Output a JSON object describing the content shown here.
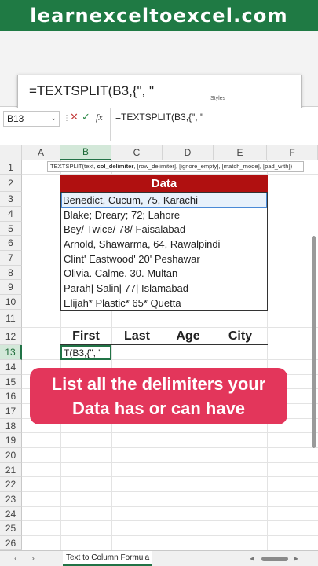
{
  "banner": {
    "text": "learnexceltoexcel.com"
  },
  "ribbon": {
    "formula_zoom": "=TEXTSPLIT(B3,{\", \"",
    "styles_label": "Styles"
  },
  "formula_bar": {
    "name_box": "B13",
    "fx_label": "fx",
    "formula": "=TEXTSPLIT(B3,{\", \""
  },
  "columns": [
    "A",
    "B",
    "C",
    "D",
    "E",
    "F"
  ],
  "rows": [
    "1",
    "2",
    "3",
    "4",
    "5",
    "6",
    "7",
    "8",
    "9",
    "10",
    "11",
    "12",
    "13",
    "14",
    "15",
    "16",
    "17",
    "18",
    "19",
    "20",
    "21",
    "22",
    "23",
    "24",
    "25",
    "26"
  ],
  "tooltip": {
    "fn": "TEXTSPLIT(text, ",
    "bold_arg": "col_delimiter",
    "rest": ", [row_delimiter], [ignore_empty], [match_mode], [pad_with])"
  },
  "table": {
    "header": "Data",
    "rows": [
      "Benedict, Cucum, 75, Karachi",
      "Blake; Dreary; 72; Lahore",
      "Bey/ Twice/ 78/ Faisalabad",
      "Arnold, Shawarma, 64, Rawalpindi",
      "Clint' Eastwood' 20' Peshawar",
      "Olivia. Calme. 30. Multan",
      "Parah| Salin| 77| Islamabad",
      "Elijah* Plastic* 65* Quetta"
    ]
  },
  "output_headers": [
    "First",
    "Last",
    "Age",
    "City"
  ],
  "edit_cell": "T(B3,{\", \"",
  "callout": {
    "line1": "List all the delimiters your",
    "line2": "Data has or can have"
  },
  "sheet_tab": "Text to Column Formula",
  "colors": {
    "banner": "#1f7a44",
    "data_header": "#b01010",
    "callout": "#e3365b",
    "excel_green": "#217346"
  }
}
